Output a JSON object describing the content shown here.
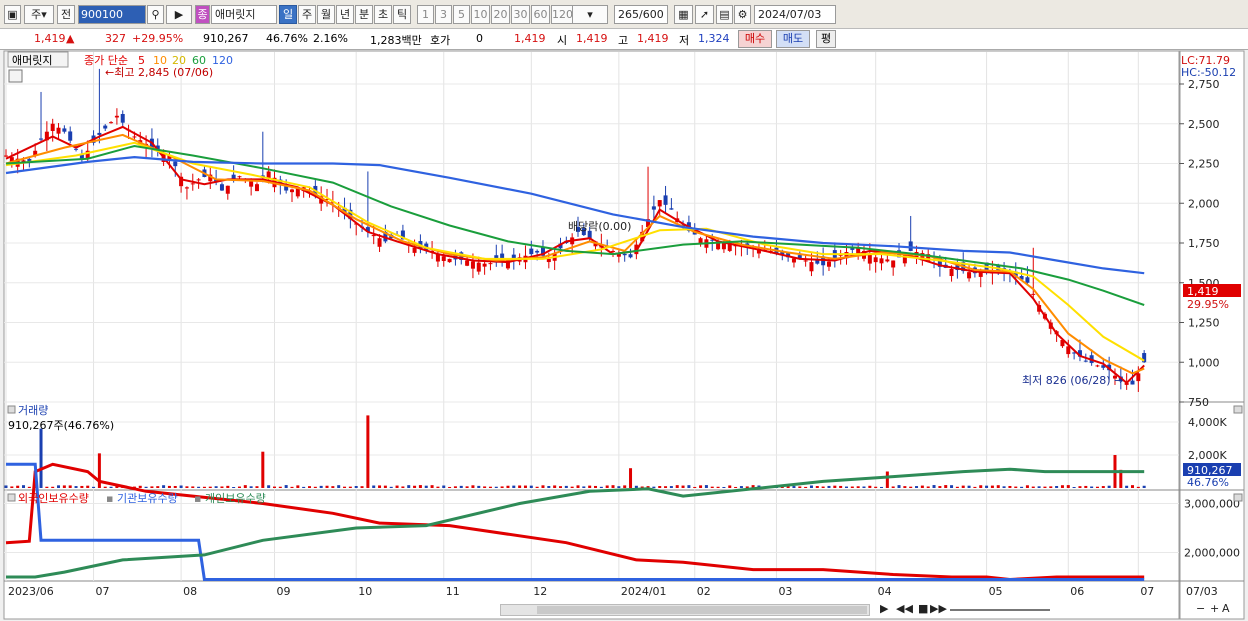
{
  "toolbar": {
    "period_day": "주",
    "prev": "전",
    "code": "900100",
    "stock_name": "애머릿지",
    "badge": "종",
    "periods": [
      "일",
      "주",
      "월",
      "년",
      "분",
      "초",
      "틱"
    ],
    "intervals": [
      "1",
      "3",
      "5",
      "10",
      "20",
      "30",
      "60",
      "120"
    ],
    "count": "265",
    "count_total": "/600",
    "date": "2024/07/03"
  },
  "info": {
    "price": "1,419",
    "change": "327",
    "change_pct": "+29.95%",
    "volume": "910,267",
    "vol_ratio": "46.76%",
    "turnover": "2.16%",
    "amount": "1,283백만",
    "hoga_label": "호가",
    "hoga_value": "0",
    "hoga_price": "1,419",
    "open_label": "시",
    "open": "1,419",
    "high_label": "고",
    "high": "1,419",
    "low_label": "저",
    "low": "1,324",
    "buy": "매수",
    "sell": "매도",
    "avg": "평"
  },
  "price_panel": {
    "title": "애머릿지",
    "legend_prefix": "종가 단순",
    "ma": [
      {
        "label": "5",
        "color": "#e00000"
      },
      {
        "label": "10",
        "color": "#ff8c00"
      },
      {
        "label": "20",
        "color": "#ffe000"
      },
      {
        "label": "60",
        "color": "#1a9e3c"
      },
      {
        "label": "120",
        "color": "#2f62e0"
      }
    ],
    "high_note": "최고 2,845 (07/06)",
    "low_note": "최저 826 (06/28)",
    "dividend_note": "배당락(0.00)",
    "lc": "LC:71.79",
    "hc": "HC:-50.12",
    "last_price": "1,419",
    "last_pct": "29.95%"
  },
  "volume_panel": {
    "title": "거래량",
    "subtitle": "910,267주(46.76%)",
    "last_value": "910,267",
    "last_pct": "46.76%"
  },
  "holding_panel": {
    "labels": [
      "외국인보유수량",
      "기관보유수량",
      "개인보유수량"
    ],
    "colors": [
      "#e00000",
      "#2f62e0",
      "#2e8b57"
    ]
  },
  "chart_data": [
    {
      "type": "candlestick",
      "title": "애머릿지",
      "y_ticks": [
        "2,750",
        "2,500",
        "2,250",
        "2,000",
        "1,750",
        "1,500",
        "1,250",
        "1,000",
        "750"
      ],
      "ylim": [
        700,
        2800
      ],
      "x_ticks": [
        "2023/06",
        "07",
        "08",
        "09",
        "10",
        "11",
        "12",
        "2024/01",
        "02",
        "03",
        "04",
        "05",
        "06",
        "07"
      ],
      "close_path": [
        [
          0,
          2300
        ],
        [
          4,
          2260
        ],
        [
          6,
          2400
        ],
        [
          8,
          2500
        ],
        [
          10,
          2450
        ],
        [
          13,
          2280
        ],
        [
          16,
          2430
        ],
        [
          19,
          2550
        ],
        [
          22,
          2420
        ],
        [
          25,
          2350
        ],
        [
          28,
          2300
        ],
        [
          31,
          2100
        ],
        [
          33,
          2150
        ],
        [
          35,
          2180
        ],
        [
          37,
          2080
        ],
        [
          40,
          2170
        ],
        [
          43,
          2120
        ],
        [
          45,
          2200
        ],
        [
          48,
          2080
        ],
        [
          51,
          2100
        ],
        [
          53,
          2060
        ],
        [
          56,
          2010
        ],
        [
          59,
          1900
        ],
        [
          62,
          1820
        ],
        [
          65,
          1760
        ],
        [
          67,
          1800
        ],
        [
          70,
          1720
        ],
        [
          73,
          1700
        ],
        [
          76,
          1650
        ],
        [
          79,
          1640
        ],
        [
          82,
          1620
        ],
        [
          85,
          1630
        ],
        [
          88,
          1660
        ],
        [
          91,
          1690
        ],
        [
          93,
          1650
        ],
        [
          96,
          1750
        ],
        [
          98,
          1820
        ],
        [
          101,
          1760
        ],
        [
          104,
          1700
        ],
        [
          107,
          1660
        ],
        [
          110,
          1900
        ],
        [
          112,
          2020
        ],
        [
          114,
          1960
        ],
        [
          116,
          1850
        ],
        [
          119,
          1780
        ],
        [
          122,
          1760
        ],
        [
          125,
          1740
        ],
        [
          128,
          1720
        ],
        [
          131,
          1700
        ],
        [
          134,
          1660
        ],
        [
          137,
          1640
        ],
        [
          140,
          1610
        ],
        [
          143,
          1680
        ],
        [
          146,
          1720
        ],
        [
          149,
          1660
        ],
        [
          152,
          1640
        ],
        [
          155,
          1700
        ],
        [
          158,
          1680
        ],
        [
          160,
          1600
        ],
        [
          163,
          1580
        ],
        [
          166,
          1560
        ],
        [
          169,
          1580
        ],
        [
          172,
          1560
        ],
        [
          175,
          1500
        ],
        [
          177,
          1360
        ],
        [
          179,
          1250
        ],
        [
          181,
          1140
        ],
        [
          183,
          1060
        ],
        [
          185,
          1010
        ],
        [
          187,
          980
        ],
        [
          189,
          950
        ],
        [
          191,
          880
        ],
        [
          193,
          860
        ],
        [
          195,
          1000
        ]
      ],
      "series": [
        {
          "name": "5",
          "values": [
            [
              0,
              2280
            ],
            [
              8,
              2420
            ],
            [
              12,
              2350
            ],
            [
              16,
              2420
            ],
            [
              20,
              2480
            ],
            [
              25,
              2380
            ],
            [
              30,
              2150
            ],
            [
              34,
              2120
            ],
            [
              38,
              2150
            ],
            [
              44,
              2150
            ],
            [
              50,
              2100
            ],
            [
              56,
              1990
            ],
            [
              62,
              1820
            ],
            [
              67,
              1760
            ],
            [
              74,
              1680
            ],
            [
              80,
              1640
            ],
            [
              86,
              1630
            ],
            [
              92,
              1680
            ],
            [
              96,
              1760
            ],
            [
              100,
              1780
            ],
            [
              104,
              1680
            ],
            [
              108,
              1700
            ],
            [
              112,
              1960
            ],
            [
              116,
              1870
            ],
            [
              122,
              1760
            ],
            [
              130,
              1700
            ],
            [
              136,
              1650
            ],
            [
              142,
              1640
            ],
            [
              148,
              1700
            ],
            [
              154,
              1680
            ],
            [
              160,
              1610
            ],
            [
              166,
              1570
            ],
            [
              172,
              1560
            ],
            [
              176,
              1400
            ],
            [
              180,
              1180
            ],
            [
              184,
              1040
            ],
            [
              188,
              990
            ],
            [
              192,
              870
            ],
            [
              195,
              980
            ]
          ]
        },
        {
          "name": "10",
          "values": [
            [
              0,
              2250
            ],
            [
              10,
              2350
            ],
            [
              20,
              2430
            ],
            [
              28,
              2300
            ],
            [
              36,
              2150
            ],
            [
              44,
              2140
            ],
            [
              52,
              2080
            ],
            [
              60,
              1900
            ],
            [
              68,
              1760
            ],
            [
              76,
              1680
            ],
            [
              84,
              1640
            ],
            [
              92,
              1660
            ],
            [
              100,
              1760
            ],
            [
              106,
              1700
            ],
            [
              112,
              1920
            ],
            [
              118,
              1820
            ],
            [
              126,
              1740
            ],
            [
              134,
              1690
            ],
            [
              142,
              1650
            ],
            [
              150,
              1690
            ],
            [
              158,
              1670
            ],
            [
              166,
              1580
            ],
            [
              172,
              1570
            ],
            [
              176,
              1460
            ],
            [
              182,
              1180
            ],
            [
              188,
              1020
            ],
            [
              193,
              930
            ],
            [
              195,
              960
            ]
          ]
        },
        {
          "name": "20",
          "values": [
            [
              0,
              2240
            ],
            [
              12,
              2300
            ],
            [
              22,
              2380
            ],
            [
              32,
              2250
            ],
            [
              42,
              2180
            ],
            [
              52,
              2100
            ],
            [
              62,
              1880
            ],
            [
              72,
              1720
            ],
            [
              82,
              1650
            ],
            [
              92,
              1650
            ],
            [
              102,
              1710
            ],
            [
              112,
              1830
            ],
            [
              120,
              1840
            ],
            [
              130,
              1740
            ],
            [
              140,
              1680
            ],
            [
              150,
              1680
            ],
            [
              160,
              1640
            ],
            [
              170,
              1590
            ],
            [
              176,
              1540
            ],
            [
              182,
              1360
            ],
            [
              188,
              1160
            ],
            [
              195,
              1010
            ]
          ]
        },
        {
          "name": "60",
          "values": [
            [
              0,
              2250
            ],
            [
              14,
              2280
            ],
            [
              22,
              2360
            ],
            [
              32,
              2300
            ],
            [
              44,
              2220
            ],
            [
              56,
              2130
            ],
            [
              66,
              1980
            ],
            [
              76,
              1860
            ],
            [
              86,
              1760
            ],
            [
              96,
              1700
            ],
            [
              104,
              1680
            ],
            [
              116,
              1740
            ],
            [
              126,
              1760
            ],
            [
              136,
              1740
            ],
            [
              146,
              1720
            ],
            [
              156,
              1680
            ],
            [
              166,
              1630
            ],
            [
              174,
              1590
            ],
            [
              182,
              1520
            ],
            [
              188,
              1450
            ],
            [
              195,
              1360
            ]
          ]
        },
        {
          "name": "120",
          "values": [
            [
              0,
              2190
            ],
            [
              14,
              2260
            ],
            [
              22,
              2290
            ],
            [
              32,
              2260
            ],
            [
              44,
              2250
            ],
            [
              56,
              2250
            ],
            [
              64,
              2240
            ],
            [
              76,
              2160
            ],
            [
              90,
              2060
            ],
            [
              104,
              1930
            ],
            [
              116,
              1850
            ],
            [
              128,
              1790
            ],
            [
              140,
              1750
            ],
            [
              152,
              1730
            ],
            [
              164,
              1700
            ],
            [
              172,
              1690
            ],
            [
              180,
              1640
            ],
            [
              188,
              1590
            ],
            [
              195,
              1560
            ]
          ]
        }
      ]
    },
    {
      "type": "bar",
      "title": "거래량",
      "y_ticks": [
        "4,000K",
        "2,000K"
      ],
      "ylim": [
        0,
        4800
      ],
      "spikes": [
        [
          6,
          3600
        ],
        [
          16,
          2100
        ],
        [
          44,
          2200
        ],
        [
          62,
          4400
        ],
        [
          107,
          1200
        ],
        [
          151,
          1000
        ],
        [
          190,
          2000
        ],
        [
          191,
          1100
        ]
      ]
    },
    {
      "type": "line",
      "y_ticks": [
        "3,000,000",
        "2,000,000"
      ],
      "ylim": [
        1350000,
        4250000
      ],
      "series": [
        {
          "name": "외국인보유수량",
          "values": [
            [
              0,
              2200000
            ],
            [
              4,
              2230000
            ],
            [
              5,
              3650000
            ],
            [
              8,
              3800000
            ],
            [
              14,
              3650000
            ],
            [
              16,
              3450000
            ],
            [
              24,
              3250000
            ],
            [
              32,
              3150000
            ],
            [
              44,
              3000000
            ],
            [
              56,
              2800000
            ],
            [
              64,
              2600000
            ],
            [
              76,
              2550000
            ],
            [
              96,
              2200000
            ],
            [
              108,
              1850000
            ],
            [
              116,
              1800000
            ],
            [
              128,
              1650000
            ],
            [
              140,
              1650000
            ],
            [
              152,
              1550000
            ],
            [
              162,
              1500000
            ],
            [
              168,
              1500000
            ],
            [
              172,
              1450000
            ],
            [
              180,
              1500000
            ],
            [
              195,
              1500000
            ]
          ]
        },
        {
          "name": "기관보유수량",
          "values": [
            [
              0,
              3800000
            ],
            [
              5,
              3800000
            ],
            [
              6,
              2250000
            ],
            [
              33,
              2250000
            ],
            [
              34,
              1450000
            ],
            [
              195,
              1450000
            ]
          ]
        },
        {
          "name": "개인보유수량",
          "values": [
            [
              0,
              1500000
            ],
            [
              5,
              1500000
            ],
            [
              10,
              1600000
            ],
            [
              20,
              1850000
            ],
            [
              34,
              1950000
            ],
            [
              44,
              2250000
            ],
            [
              60,
              2500000
            ],
            [
              72,
              2550000
            ],
            [
              88,
              3000000
            ],
            [
              100,
              3250000
            ],
            [
              110,
              3300000
            ],
            [
              116,
              3150000
            ],
            [
              128,
              3300000
            ],
            [
              140,
              3450000
            ],
            [
              152,
              3550000
            ],
            [
              164,
              3650000
            ],
            [
              172,
              3700000
            ],
            [
              178,
              3650000
            ],
            [
              195,
              3650000
            ]
          ]
        }
      ]
    }
  ]
}
